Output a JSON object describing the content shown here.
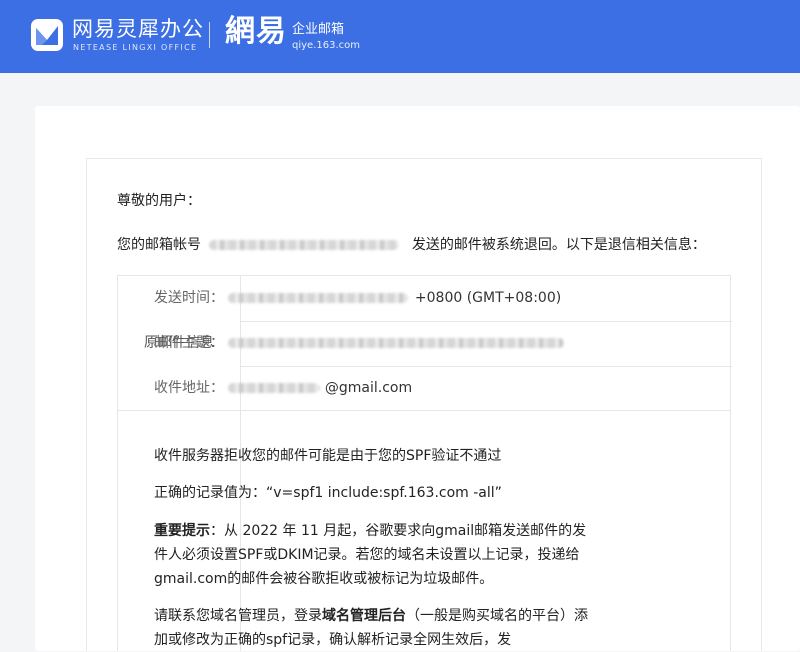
{
  "header": {
    "brand_cn": "网易灵犀办公",
    "brand_en": "NETEASE LINGXI OFFICE",
    "brand2_cn": "網易",
    "brand2_sub": "企业邮箱",
    "brand2_url": "qiye.163.com",
    "accent": "#3b6fe3"
  },
  "mail": {
    "greeting": "尊敬的用户：",
    "intro_prefix": "您的邮箱帐号",
    "intro_suffix": "发送的邮件被系统退回。以下是退信相关信息：",
    "original_info_label": "原邮件信息",
    "send_time_label": "发送时间：",
    "send_time_value": "+0800 (GMT+08:00)",
    "subject_label": "邮件主题：",
    "recipient_label": "收件地址：",
    "recipient_value": "@gmail.com",
    "reason_line": "收件服务器拒收您的邮件可能是由于您的SPF验证不通过",
    "correct_record_prefix": "正确的记录值为：",
    "correct_record_value": "“v=spf1 include:spf.163.com -all”",
    "important_label": "重要提示",
    "important_text": "：从 2022 年 11 月起，谷歌要求向gmail邮箱发送邮件的发件人必须设置SPF或DKIM记录。若您的域名未设置以上记录，投递给gmail.com的邮件会被谷歌拒收或被标记为垃圾邮件。",
    "contact_prefix": "请联系您域名管理员，登录",
    "contact_bold": "域名管理后台",
    "contact_text": "（一般是购买域名的平台）添加或修改为正确的spf记录，确认解析记录全网生效后，发"
  }
}
